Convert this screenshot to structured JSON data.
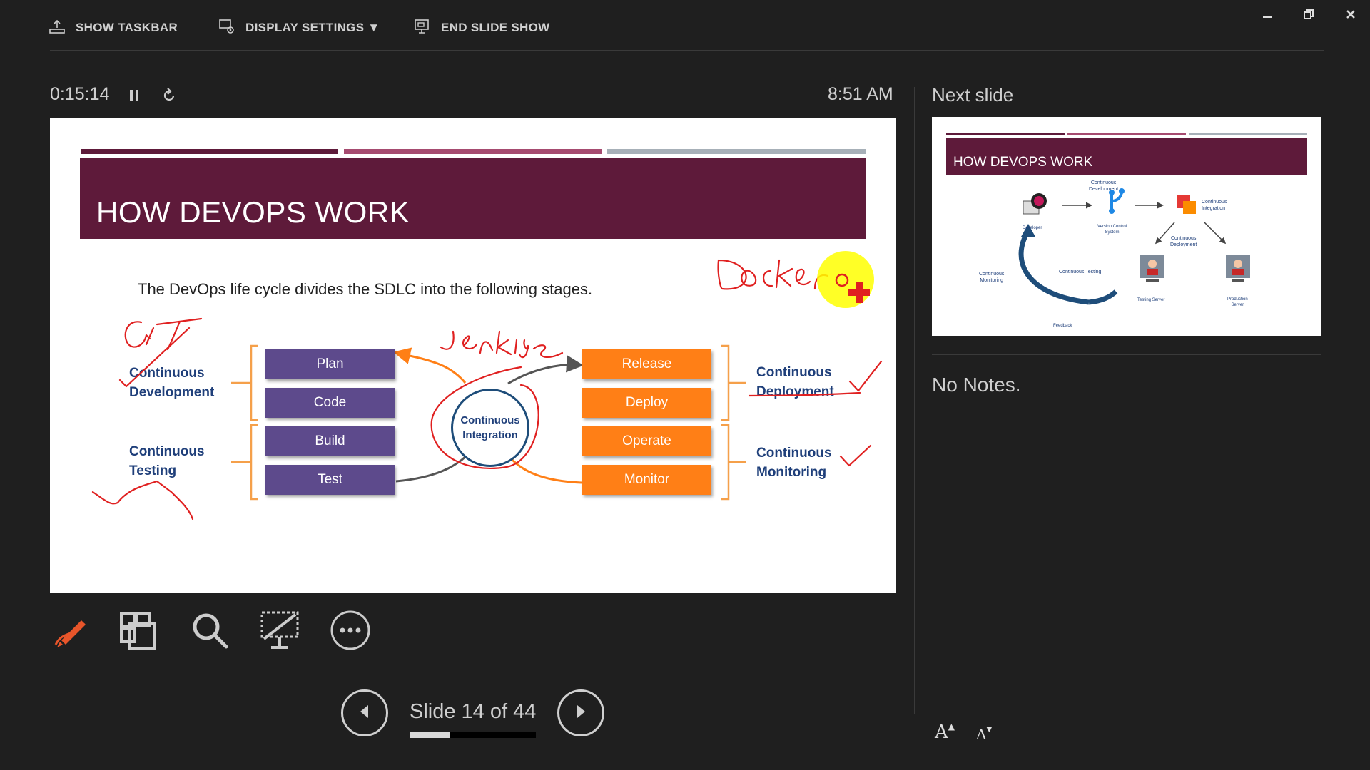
{
  "toolbar": {
    "show_taskbar": "SHOW TASKBAR",
    "display_settings": "DISPLAY SETTINGS ▼",
    "end_slide_show": "END SLIDE SHOW"
  },
  "timer": {
    "elapsed": "0:15:14",
    "clock": "8:51 AM"
  },
  "slide": {
    "title": "HOW DEVOPS  WORK",
    "subtitle": "The DevOps life cycle divides the SDLC into the following stages.",
    "left_stages": [
      "Plan",
      "Code",
      "Build",
      "Test"
    ],
    "right_stages": [
      "Release",
      "Deploy",
      "Operate",
      "Monitor"
    ],
    "center": [
      "Continuous",
      "Integration"
    ],
    "groups": {
      "dev": [
        "Continuous",
        "Development"
      ],
      "test": [
        "Continuous",
        "Testing"
      ],
      "deploy": [
        "Continuous",
        "Deployment"
      ],
      "monitor": [
        "Continuous",
        "Monitoring"
      ]
    },
    "colors": {
      "band": "#5e1a3a",
      "purple": "#5d4a8c",
      "orange": "#ff7f16",
      "ink": "#e02020"
    }
  },
  "next_slide": {
    "label": "Next slide",
    "title": "HOW DEVOPS  WORK",
    "labels": {
      "cd": [
        "Continuous",
        "Development"
      ],
      "ci": [
        "Continuous",
        "Integration"
      ],
      "developer": "Developer",
      "vcs": [
        "Version Control",
        "System"
      ],
      "cdep": [
        "Continuous",
        "Deployment"
      ],
      "cmon": [
        "Continuous",
        "Monitoring"
      ],
      "ctest": "Continuous Testing",
      "test_server": "Testing Server",
      "prod_server": [
        "Production",
        "Server"
      ],
      "feedback": "Feedback"
    }
  },
  "notes": {
    "text": "No Notes."
  },
  "navigation": {
    "slide_label": "Slide 14 of 44",
    "current": 14,
    "total": 44
  },
  "font_controls": {
    "increase": "A",
    "decrease": "A"
  },
  "icons": [
    "taskbar-icon",
    "display-settings-icon",
    "end-show-icon",
    "pause-icon",
    "refresh-icon",
    "pen-icon",
    "grid-icon",
    "magnifier-icon",
    "black-screen-icon",
    "more-icon",
    "prev-icon",
    "next-icon",
    "minimize-icon",
    "restore-icon",
    "close-icon"
  ]
}
